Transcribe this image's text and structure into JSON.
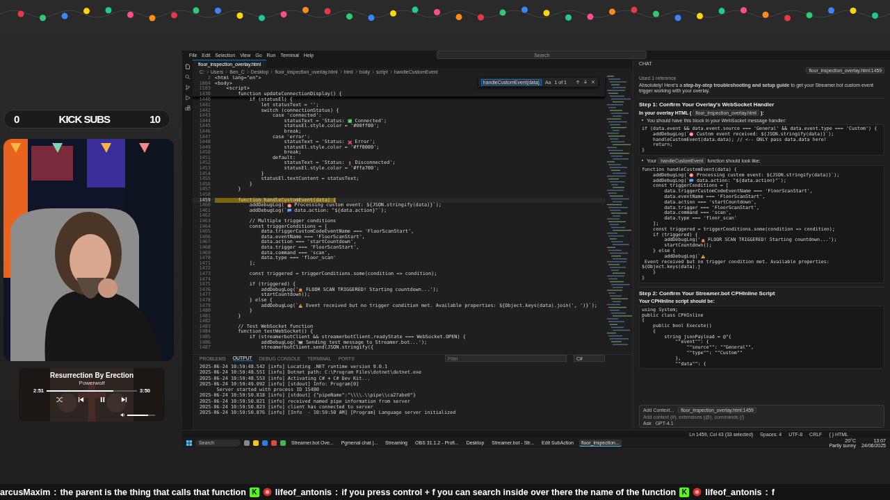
{
  "overlay": {
    "subs": {
      "current": "0",
      "label": "KICK SUBS",
      "goal": "10"
    },
    "music_player": {
      "title": "Resurrection By Erection",
      "artist": "Powerwolf",
      "elapsed": "2:51",
      "duration": "3:50",
      "level": 0.74,
      "volume": {
        "level": 0.75
      }
    }
  },
  "window": {
    "menu": [
      "File",
      "Edit",
      "Selection",
      "View",
      "Go",
      "Run",
      "Terminal",
      "Help"
    ],
    "search": {
      "placeholder": "Search"
    },
    "tabs": [
      {
        "label": "floor_inspection_overlay.html",
        "selected": true
      }
    ],
    "breadcrumb": [
      "C:",
      "Users",
      "Ben_C",
      "Desktop",
      "floor_inspection_overlay.html",
      "html",
      "body",
      "script",
      "handleCustomEvent"
    ],
    "find": {
      "value": "handleCustomEvent(data)",
      "case_toggle": "Aa",
      "result": "1 of 1"
    },
    "sticky_lines": [
      {
        "n": "2",
        "code": "<html lang=\"en\">"
      },
      {
        "n": "1004",
        "code": "<body>"
      },
      {
        "n": "1183",
        "code": "    <script>"
      },
      {
        "n": "1438",
        "code": "        function updateConnectionDisplay() {"
      }
    ],
    "lines": [
      {
        "n": "1440",
        "code": "            if (statusEl) {"
      },
      {
        "n": "1441",
        "code": "                let statusText = '';"
      },
      {
        "n": "1442",
        "code": "                switch (connectionStatus) {"
      },
      {
        "n": "1443",
        "code": "                    case 'connected':"
      },
      {
        "n": "1444",
        "code": "                        statusText = 'Status: ",
        "code_after": " Connected';"
      },
      {
        "n": "1445",
        "code": "                        statusEl.style.color = '#00ff00';"
      },
      {
        "n": "1446",
        "code": "                        break;"
      },
      {
        "n": "1447",
        "code": "                    case 'error':"
      },
      {
        "n": "1448",
        "code": "                        statusText = 'Status: ",
        "code_after": " Error';"
      },
      {
        "n": "1449",
        "code": "                        statusEl.style.color = '#ff0000';"
      },
      {
        "n": "1450",
        "code": "                        break;"
      },
      {
        "n": "1451",
        "code": "                    default:"
      },
      {
        "n": "1452",
        "code": "                        statusText = 'Status: ",
        "code_after": " Disconnected';"
      },
      {
        "n": "1453",
        "code": "                        statusEl.style.color = '#ffa700';"
      },
      {
        "n": "1454",
        "code": "                }"
      },
      {
        "n": "1455",
        "code": "                statusEl.textContent = statusText;"
      },
      {
        "n": "1456",
        "code": "            }"
      },
      {
        "n": "1457",
        "code": "        }"
      },
      {
        "n": "1458"
      },
      {
        "n": "1459",
        "code": "        function handleCustomEvent(data) {",
        "selected": true
      },
      {
        "n": "1460",
        "code": "            addDebugLog(`",
        "code_after": " Processing custom event: ${JSON.stringify(data)}`);"
      },
      {
        "n": "1461",
        "code": "            addDebugLog(`",
        "code_after": " data.action: \"${data.action}\"`);"
      },
      {
        "n": "1462"
      },
      {
        "n": "1463",
        "code": "            // Multiple trigger conditions"
      },
      {
        "n": "1464",
        "code": "            const triggerConditions = ["
      },
      {
        "n": "1465",
        "code": "                data.triggerCustomCodeEventName === 'FloorScanStart',"
      },
      {
        "n": "1466",
        "code": "                data.eventName === 'FloorScanStart',"
      },
      {
        "n": "1467",
        "code": "                data.action === 'startCountdown',"
      },
      {
        "n": "1468",
        "code": "                data.trigger === 'FloorScanStart',"
      },
      {
        "n": "1469",
        "code": "                data.command === 'scan',"
      },
      {
        "n": "1470",
        "code": "                data.type === 'floor_scan'"
      },
      {
        "n": "1471",
        "code": "            ];"
      },
      {
        "n": "1472"
      },
      {
        "n": "1473",
        "code": "            const triggered = triggerConditions.some(condition => condition);"
      },
      {
        "n": "1474"
      },
      {
        "n": "1475",
        "code": "            if (triggered) {"
      },
      {
        "n": "1476",
        "code": "                addDebugLog('",
        "code_after": " FLOOR SCAN TRIGGERED! Starting countdown...');"
      },
      {
        "n": "1477",
        "code": "                startCountdown();"
      },
      {
        "n": "1478",
        "code": "            } else {"
      },
      {
        "n": "1479",
        "code": "                addDebugLog(`",
        "code_after": " Event received but no trigger condition met. Available properties: ${Object.keys(data).join(', ')}`);"
      },
      {
        "n": "1480",
        "code": "            }"
      },
      {
        "n": "1481",
        "code": "        }"
      },
      {
        "n": "1482"
      },
      {
        "n": "1483",
        "code": "        // Test WebSocket function"
      },
      {
        "n": "1484",
        "code": "        function testWebSocket() {"
      },
      {
        "n": "1485",
        "code": "            if (streamerbotClient && streamerbotClient.readyState === WebSocket.OPEN) {"
      },
      {
        "n": "1486",
        "code": "                addDebugLog('",
        "code_after": " Sending test message to Streamer.bot...');"
      },
      {
        "n": "1487",
        "code": "                streamerbotClient.send(JSON.stringify({"
      }
    ],
    "panel": {
      "tabs": [
        {
          "label": "PROBLEMS",
          "selected": false
        },
        {
          "label": "OUTPUT",
          "selected": true
        },
        {
          "label": "DEBUG CONSOLE",
          "selected": false
        },
        {
          "label": "TERMINAL",
          "selected": false
        },
        {
          "label": "PORTS",
          "selected": false
        }
      ],
      "filter": {
        "placeholder": "Filter"
      },
      "channel": "C#",
      "output": [
        "2025-06-24 10:59:48.542 [info] Locating .NET runtime version 9.0.1",
        "2025-06-24 10:59:48.551 [info] Dotnet path: C:\\Program Files\\dotnet\\dotnet.exe",
        "2025-06-24 10:59:48.553 [info] Activating C# + C# Dev Kit...",
        "2025-06-24 10:59:49.092 [info] [stdout] Info: Program[0]",
        "      Server started with process ID 15480",
        "2025-06-24 10:59:50.818 [info] [stdout] {\"pipeName\":\"\\\\\\\\.\\\\pipe\\\\ca27abe0\"}",
        "2025-06-24 10:59:50.821 [info] received named pipe information from server",
        "2025-06-24 10:59:50.823 [info] client has connected to server",
        "2025-06-24 10:59:50.876 [info] [Info  - 10:59:50 AM] [Program] Language server initialized"
      ]
    },
    "chat": {
      "title": "CHAT",
      "file_chip": "floor_inspection_overlay.html:1459",
      "reference": "Used 1 reference",
      "intro": "Absolutely! Here's a **step-by-step troubleshooting and setup guide** to get your Streamer.bot custom event trigger working with your overlay.",
      "step1": {
        "heading": "Step 1: Confirm Your Overlay's WebSocket Handler",
        "lead": "In your overlay HTML (",
        "file": "floor_inspection_overlay.html",
        "tail": "):",
        "bullet": "You should have this block in your WebSocket message handler:",
        "code": [
          {
            "code": "if (data.event && data.event.source === 'General' && data.event.type === 'Custom') {"
          },
          {
            "code": "    addDebugLog(`",
            "code_after": " Custom event received: ${JSON.stringify(data)}`);"
          },
          {
            "code": "    handleCustomEvent(data.data); // <-- ONLY pass data.data here!"
          },
          {
            "code": "    return;"
          },
          {
            "code": "}"
          }
        ],
        "bullet2": {
          "lead": "Your",
          "chip": "handleCustomEvent",
          "tail": "function should look like:"
        },
        "code2": [
          {
            "code": "function handleCustomEvent(data) {"
          },
          {
            "code": "    addDebugLog(`",
            "code_after": " Processing custom event: ${JSON.stringify(data)}`);"
          },
          {
            "code": "    addDebugLog(`",
            "code_after": " data.action: \"${data.action}\"`);"
          },
          {
            "code": "    const triggerConditions = ["
          },
          {
            "code": "        data.triggerCustomCodeEventName === 'FloorScanStart',"
          },
          {
            "code": "        data.eventName === 'FloorScanStart',"
          },
          {
            "code": "        data.action === 'startCountdown',"
          },
          {
            "code": "        data.trigger === 'FloorScanStart',"
          },
          {
            "code": "        data.command === 'scan',"
          },
          {
            "code": "        data.type === 'floor_scan'"
          },
          {
            "code": "    ];"
          },
          {
            "code": "    const triggered = triggerConditions.some(condition => condition);"
          },
          {
            "code": "    if (triggered) {"
          },
          {
            "code": "        addDebugLog('",
            "code_after": " FLOOR SCAN TRIGGERED! Starting countdown...');"
          },
          {
            "code": "        startCountdown();"
          },
          {
            "code": "    } else {"
          },
          {
            "code": "        addDebugLog(`",
            "code_after": " Event received but no trigger condition met. Available properties: ${Object.keys(data).j"
          },
          {
            "code": "    }"
          },
          {
            "code": "}"
          }
        ]
      },
      "step2": {
        "heading": "Step 2: Confirm Your Streamer.bot CPHInline Script",
        "lead": "Your CPHInline script should be:",
        "code": [
          {
            "code": "using System;"
          },
          {
            "code": "public class CPHInline"
          },
          {
            "code": "{"
          },
          {
            "code": "    public bool Execute()"
          },
          {
            "code": "    {"
          },
          {
            "code": "        string jsonPayload = @\"{"
          },
          {
            "code": "            \"\"event\"\": {"
          },
          {
            "code": "                \"\"source\"\": \"\"General\"\","
          },
          {
            "code": "                \"\"type\"\": \"\"Custom\"\""
          },
          {
            "code": "            },"
          },
          {
            "code": "            \"\"data\"\": {"
          }
        ]
      },
      "input": {
        "add_context": "Add Context...",
        "chip": "floor_inspection_overlay.html:1459",
        "placeholder": "Add context (#), extensions (@), commands (/)",
        "mode": "Ask",
        "model": "GPT-4.1"
      }
    },
    "status_bar": [
      "Ln 1459, Col 43 (33 selected)",
      "Spaces: 4",
      "UTF-8",
      "CRLF",
      "{ } HTML"
    ]
  },
  "taskbar": {
    "search": "Search",
    "apps": [
      {
        "label": "Streamer.bot Ove...",
        "selected": false
      },
      {
        "label": "Pgmenal chat |...",
        "selected": false
      },
      {
        "label": "Streaming",
        "selected": false
      },
      {
        "label": "OBS 31.1.2 - Profi...",
        "selected": false
      },
      {
        "label": "Desktop",
        "selected": false
      },
      {
        "label": "Streamer.bot - Str...",
        "selected": false
      },
      {
        "label": "Edit SubAction",
        "selected": false
      },
      {
        "label": "floor_inspection...",
        "selected": true
      }
    ],
    "weather": {
      "temp": "20°C",
      "text": "Partly sunny"
    },
    "time": "13:07",
    "date": "24/06/2025"
  },
  "ticker": [
    {
      "user": "arcusMaxim",
      "sep": ":",
      "message": "the parent is the thing that calls that function"
    },
    {
      "badge": "K",
      "user": "lifeof_antonis",
      "sep": ":",
      "message": "if you press control + f you can search inside over there the name of the function"
    },
    {
      "badge": "K",
      "user": "lifeof_antonis",
      "sep": ":",
      "message": "f"
    }
  ]
}
